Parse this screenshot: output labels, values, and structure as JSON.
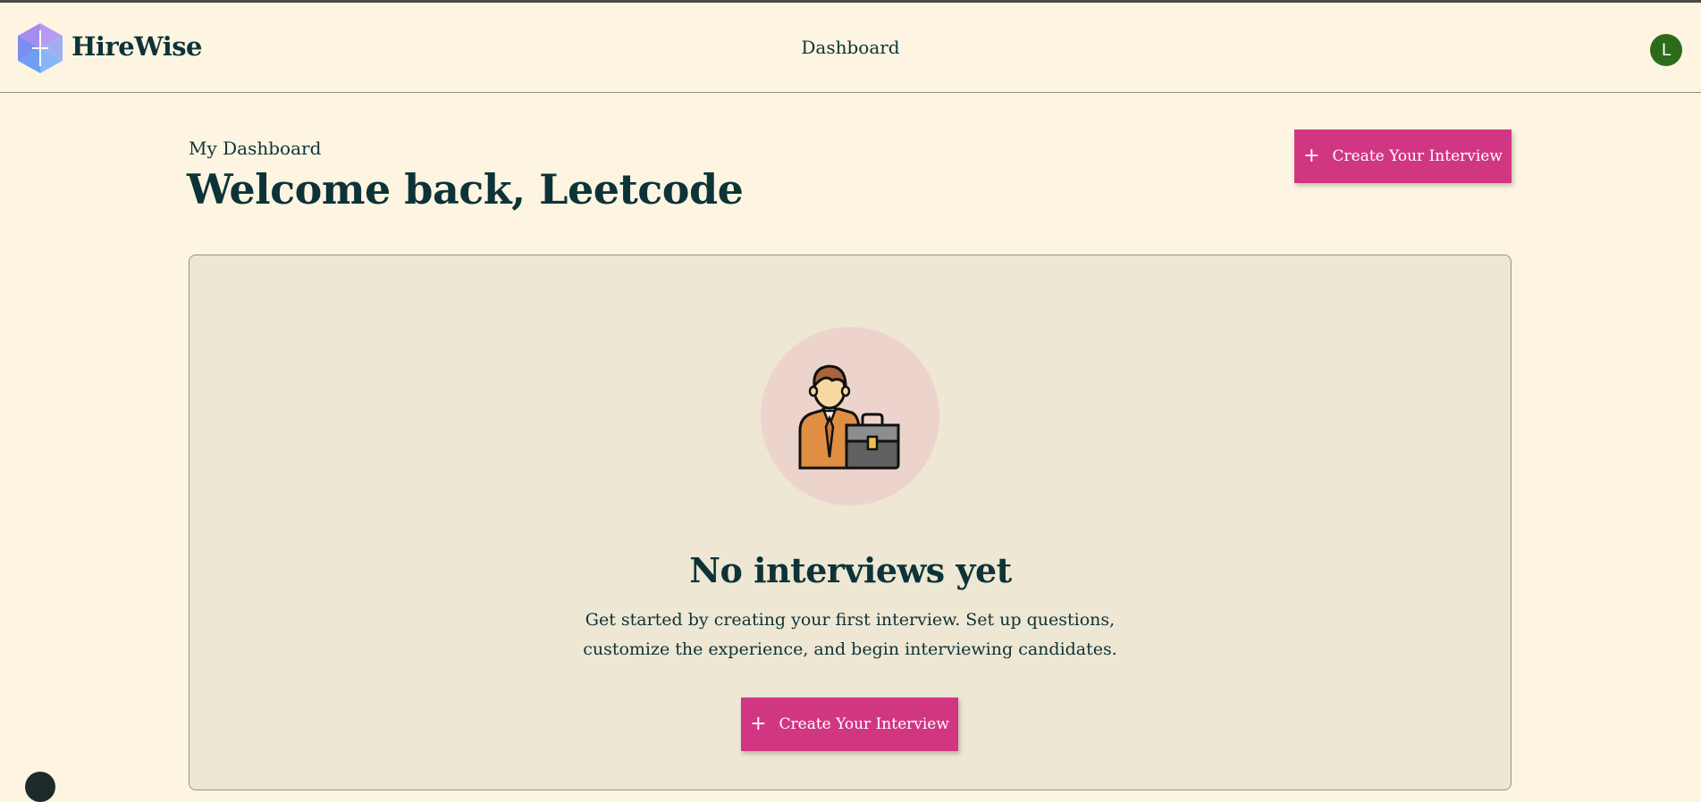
{
  "header": {
    "brand": "HireWise",
    "logo_icon": "hexagon-logo-icon",
    "nav_item": "Dashboard",
    "avatar_initial": "L"
  },
  "main": {
    "subtitle": "My Dashboard",
    "welcome": "Welcome back, Leetcode",
    "create_button": {
      "icon": "plus-icon",
      "label": "Create Your Interview"
    }
  },
  "empty_state": {
    "illustration": "businessman-briefcase-icon",
    "title": "No interviews yet",
    "description": "Get started by creating your first interview. Set up questions, customize the experience, and begin interviewing candidates.",
    "create_button": {
      "icon": "plus-icon",
      "label": "Create Your Interview"
    }
  },
  "colors": {
    "background": "#fdf5e1",
    "card": "#eee7d3",
    "text": "#0d3338",
    "accent": "#d13683",
    "avatar": "#2c6b1c"
  }
}
